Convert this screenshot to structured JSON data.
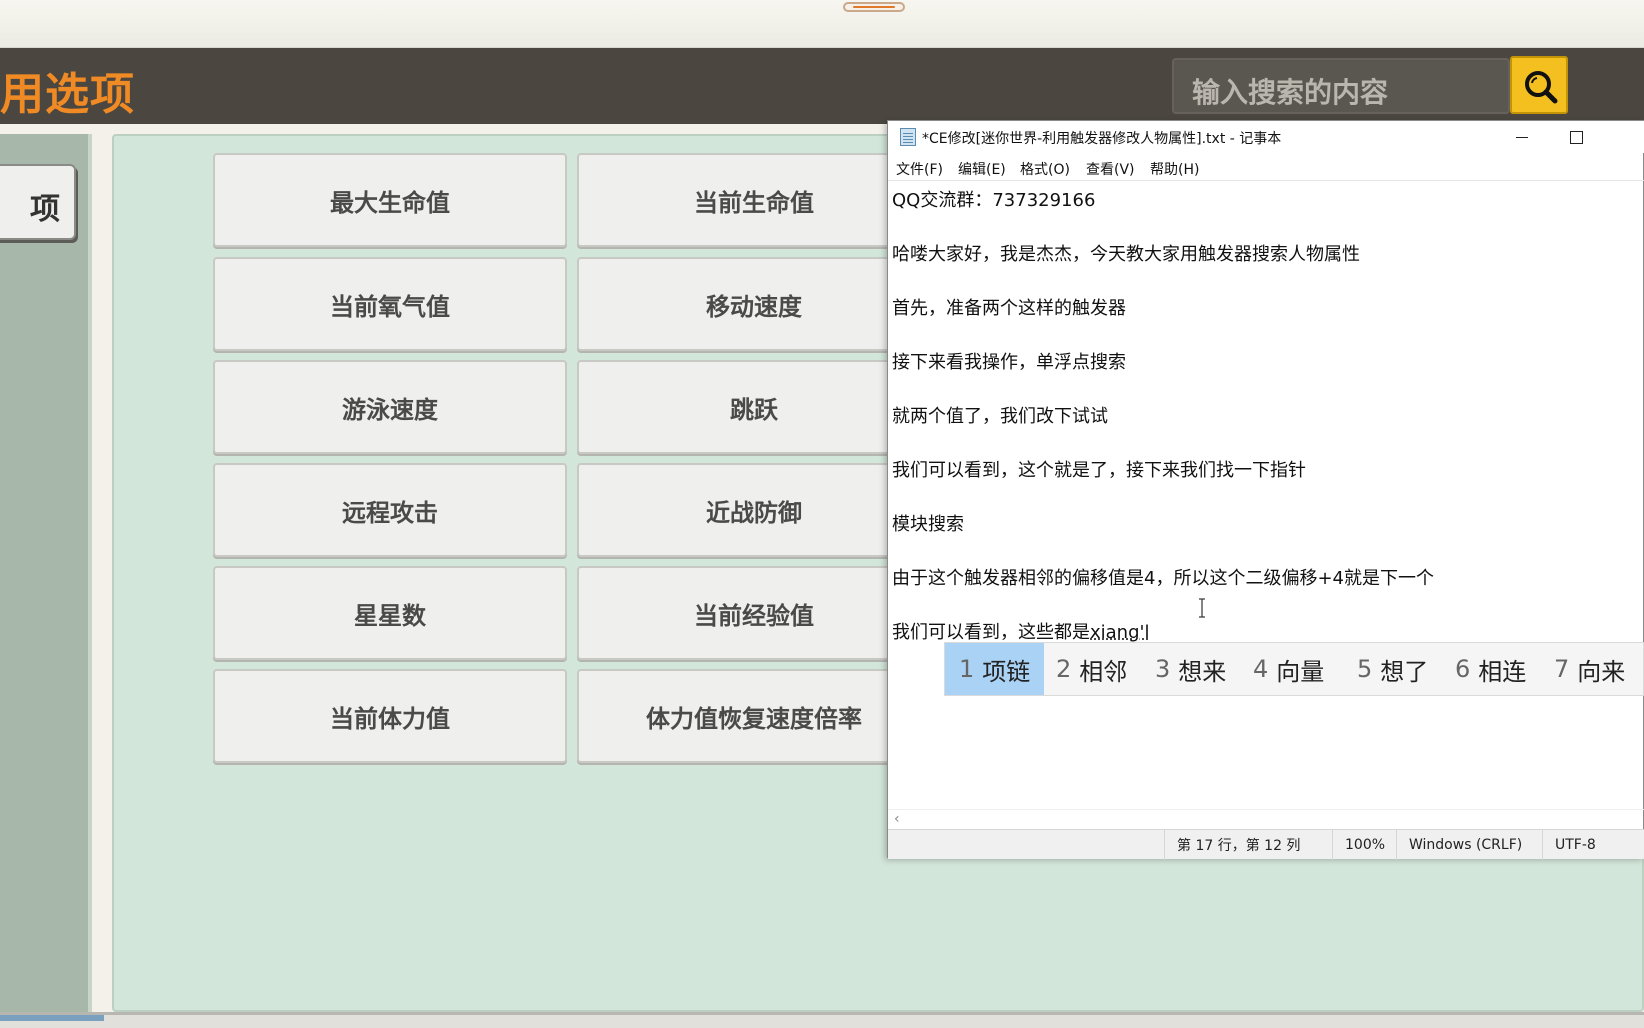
{
  "header": {
    "title": "用选项",
    "search_placeholder": "输入搜索的内容"
  },
  "sidebar": {
    "tab_label": "项"
  },
  "options": [
    "最大生命值",
    "当前生命值",
    "当前氧气值",
    "移动速度",
    "游泳速度",
    "跳跃",
    "远程攻击",
    "近战防御",
    "星星数",
    "当前经验值",
    "当前体力值",
    "体力值恢复速度倍率"
  ],
  "notepad": {
    "title": "*CE修改[迷你世界-利用触发器修改人物属性].txt - 记事本",
    "menu": [
      "文件(F)",
      "编辑(E)",
      "格式(O)",
      "查看(V)",
      "帮助(H)"
    ],
    "lines": [
      "QQ交流群：737329166",
      "哈喽大家好，我是杰杰，今天教大家用触发器搜索人物属性",
      "首先，准备两个这样的触发器",
      "接下来看我操作，单浮点搜索",
      "就两个值了，我们改下试试",
      "我们可以看到，这个就是了，接下来我们找一下指针",
      "模块搜索",
      "由于这个触发器相邻的偏移值是4，所以这个二级偏移+4就是下一个"
    ],
    "current_line_prefix": "我们可以看到，这些都是",
    "ime_composition": "xiang'l",
    "status": {
      "position": "第 17 行，第 12 列",
      "zoom": "100%",
      "line_ending": "Windows (CRLF)",
      "encoding": "UTF-8"
    }
  },
  "ime": {
    "candidates": [
      {
        "num": "1",
        "text": "项链"
      },
      {
        "num": "2",
        "text": "相邻"
      },
      {
        "num": "3",
        "text": "想来"
      },
      {
        "num": "4",
        "text": "向量"
      },
      {
        "num": "5",
        "text": "想了"
      },
      {
        "num": "6",
        "text": "相连"
      },
      {
        "num": "7",
        "text": "向来"
      }
    ]
  },
  "colors": {
    "header_bg": "#4b4740",
    "title_orange": "#f08a24",
    "search_button": "#f4c020",
    "panel_bg": "#d3e6da",
    "ime_selected": "#a9d2f5"
  }
}
